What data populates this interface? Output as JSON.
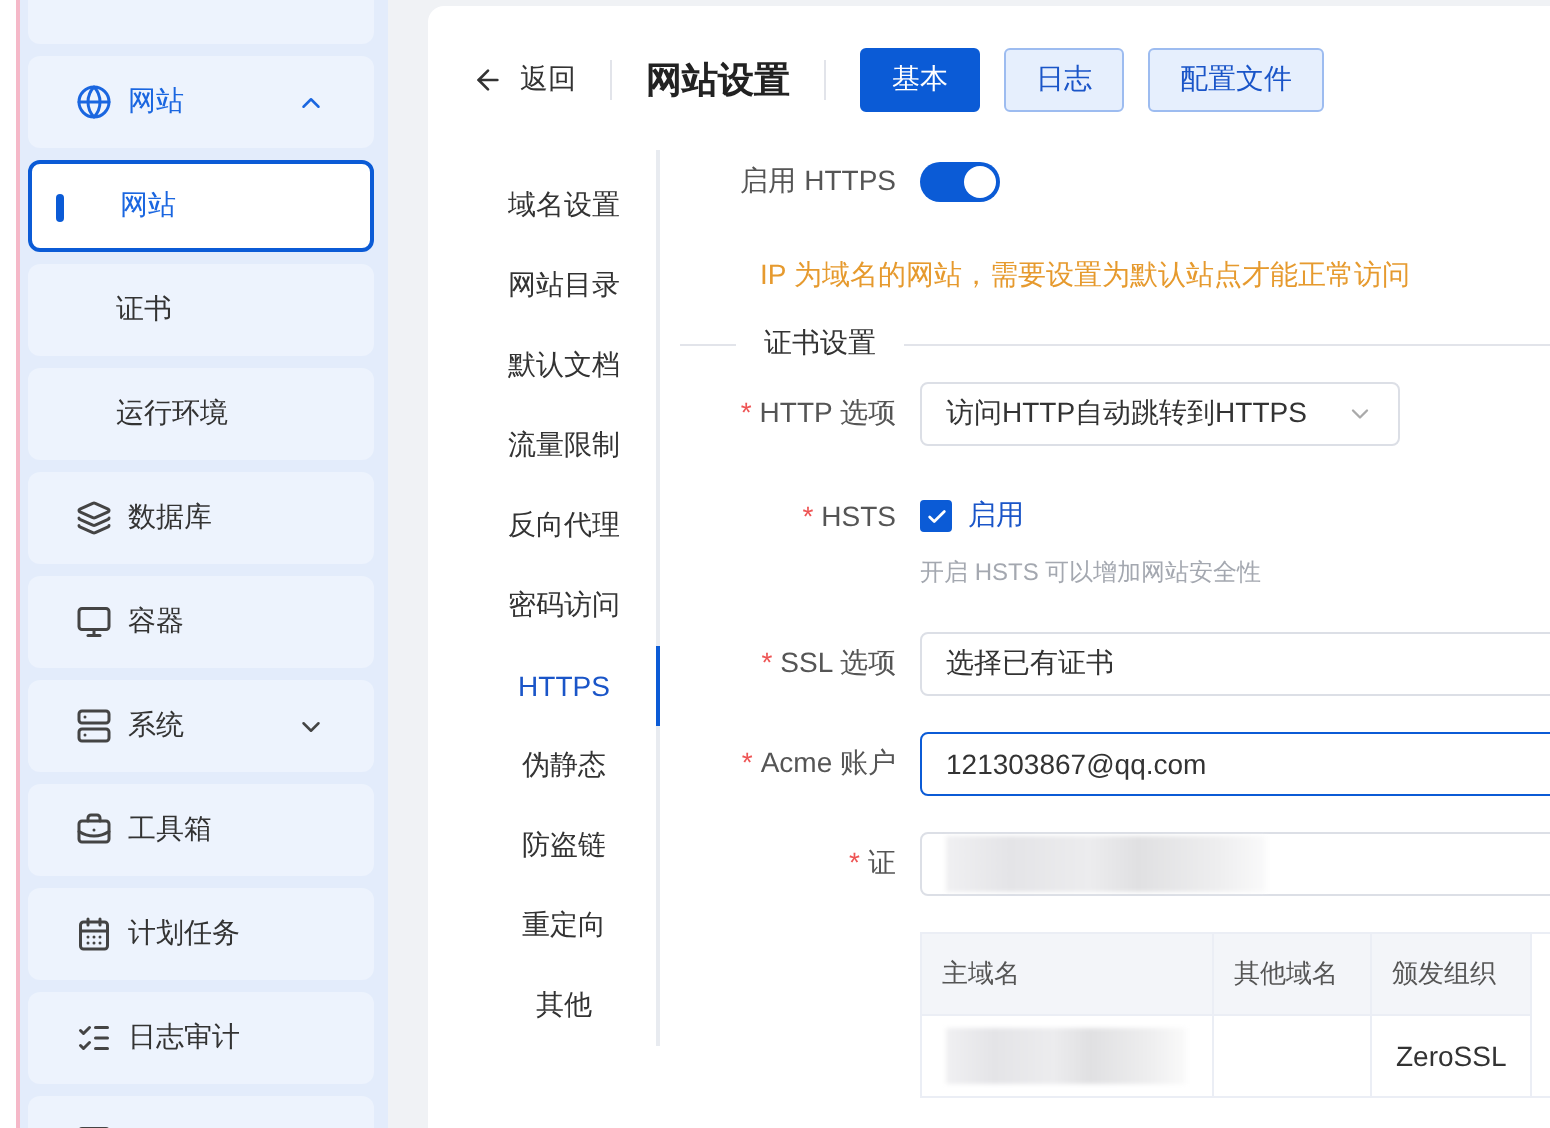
{
  "sidebar": {
    "items": [
      {
        "kind": "blank",
        "selected": false
      },
      {
        "kind": "group",
        "label": "网站",
        "expanded": true,
        "selected": true,
        "children": [
          {
            "label": "网站",
            "selected": true
          },
          {
            "label": "证书",
            "selected": false
          },
          {
            "label": "运行环境",
            "selected": false
          }
        ]
      },
      {
        "kind": "item",
        "label": "数据库",
        "selected": false
      },
      {
        "kind": "item",
        "label": "容器",
        "selected": false
      },
      {
        "kind": "group",
        "label": "系统",
        "expanded": false,
        "selected": false
      },
      {
        "kind": "item",
        "label": "工具箱",
        "selected": false
      },
      {
        "kind": "item",
        "label": "计划任务",
        "selected": false
      },
      {
        "kind": "item",
        "label": "日志审计",
        "selected": false
      },
      {
        "kind": "blank",
        "selected": false
      }
    ]
  },
  "header": {
    "back": "返回",
    "title": "网站设置",
    "tabs": [
      {
        "label": "基本",
        "selected": true
      },
      {
        "label": "日志",
        "selected": false
      },
      {
        "label": "配置文件",
        "selected": false
      }
    ]
  },
  "settings_nav": [
    {
      "label": "域名设置",
      "selected": false
    },
    {
      "label": "网站目录",
      "selected": false
    },
    {
      "label": "默认文档",
      "selected": false
    },
    {
      "label": "流量限制",
      "selected": false
    },
    {
      "label": "反向代理",
      "selected": false
    },
    {
      "label": "密码访问",
      "selected": false
    },
    {
      "label": "HTTPS",
      "selected": true
    },
    {
      "label": "伪静态",
      "selected": false
    },
    {
      "label": "防盗链",
      "selected": false
    },
    {
      "label": "重定向",
      "selected": false
    },
    {
      "label": "其他",
      "selected": false
    }
  ],
  "form": {
    "https": {
      "label": "启用 HTTPS",
      "on": true
    },
    "warning": "IP 为域名的网站，需要设置为默认站点才能正常访问",
    "section": "证书设置",
    "http_option": {
      "label": "HTTP 选项",
      "marker": "*",
      "value": "访问HTTP自动跳转到HTTPS"
    },
    "hsts": {
      "label": "HSTS",
      "marker": "*",
      "checked": true,
      "text": "启用",
      "hint": "开启 HSTS 可以增加网站安全性"
    },
    "ssl_option": {
      "label": "SSL 选项",
      "marker": "*",
      "value": "选择已有证书"
    },
    "acme": {
      "label": "Acme 账户",
      "marker": "*",
      "value": "121303867@qq.com",
      "focused": true
    },
    "certificate": {
      "label": "证",
      "marker": "*"
    }
  },
  "table": {
    "columns": [
      "主域名",
      "其他域名",
      "颁发组织"
    ],
    "rows": [
      [
        "",
        "",
        "ZeroSSL"
      ]
    ]
  }
}
